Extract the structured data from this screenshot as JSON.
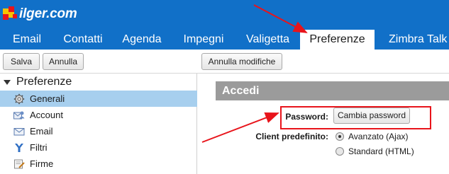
{
  "app": {
    "logo_text": "ilger.com"
  },
  "tabs": [
    {
      "label": "Email"
    },
    {
      "label": "Contatti"
    },
    {
      "label": "Agenda"
    },
    {
      "label": "Impegni"
    },
    {
      "label": "Valigetta"
    },
    {
      "label": "Preferenze",
      "active": true
    },
    {
      "label": "Zimbra Talk"
    }
  ],
  "toolbar": {
    "save_label": "Salva",
    "cancel_label": "Annulla",
    "undo_changes_label": "Annulla modifiche"
  },
  "sidebar": {
    "title": "Preferenze",
    "items": [
      {
        "label": "Generali",
        "icon": "gear-icon",
        "selected": true
      },
      {
        "label": "Account",
        "icon": "account-icon"
      },
      {
        "label": "Email",
        "icon": "mail-icon"
      },
      {
        "label": "Filtri",
        "icon": "filter-icon"
      },
      {
        "label": "Firme",
        "icon": "signature-icon"
      }
    ]
  },
  "main": {
    "section_title": "Accedi",
    "password_label": "Password:",
    "change_password_label": "Cambia password",
    "default_client_label": "Client predefinito:",
    "client_options": [
      {
        "label": "Avanzato (Ajax)",
        "selected": true
      },
      {
        "label": "Standard (HTML)",
        "selected": false
      }
    ]
  },
  "colors": {
    "header_blue": "#1170c8",
    "selected_item": "#a7cfee",
    "section_header": "#9b9b9b",
    "annotation_red": "#e8141b"
  }
}
